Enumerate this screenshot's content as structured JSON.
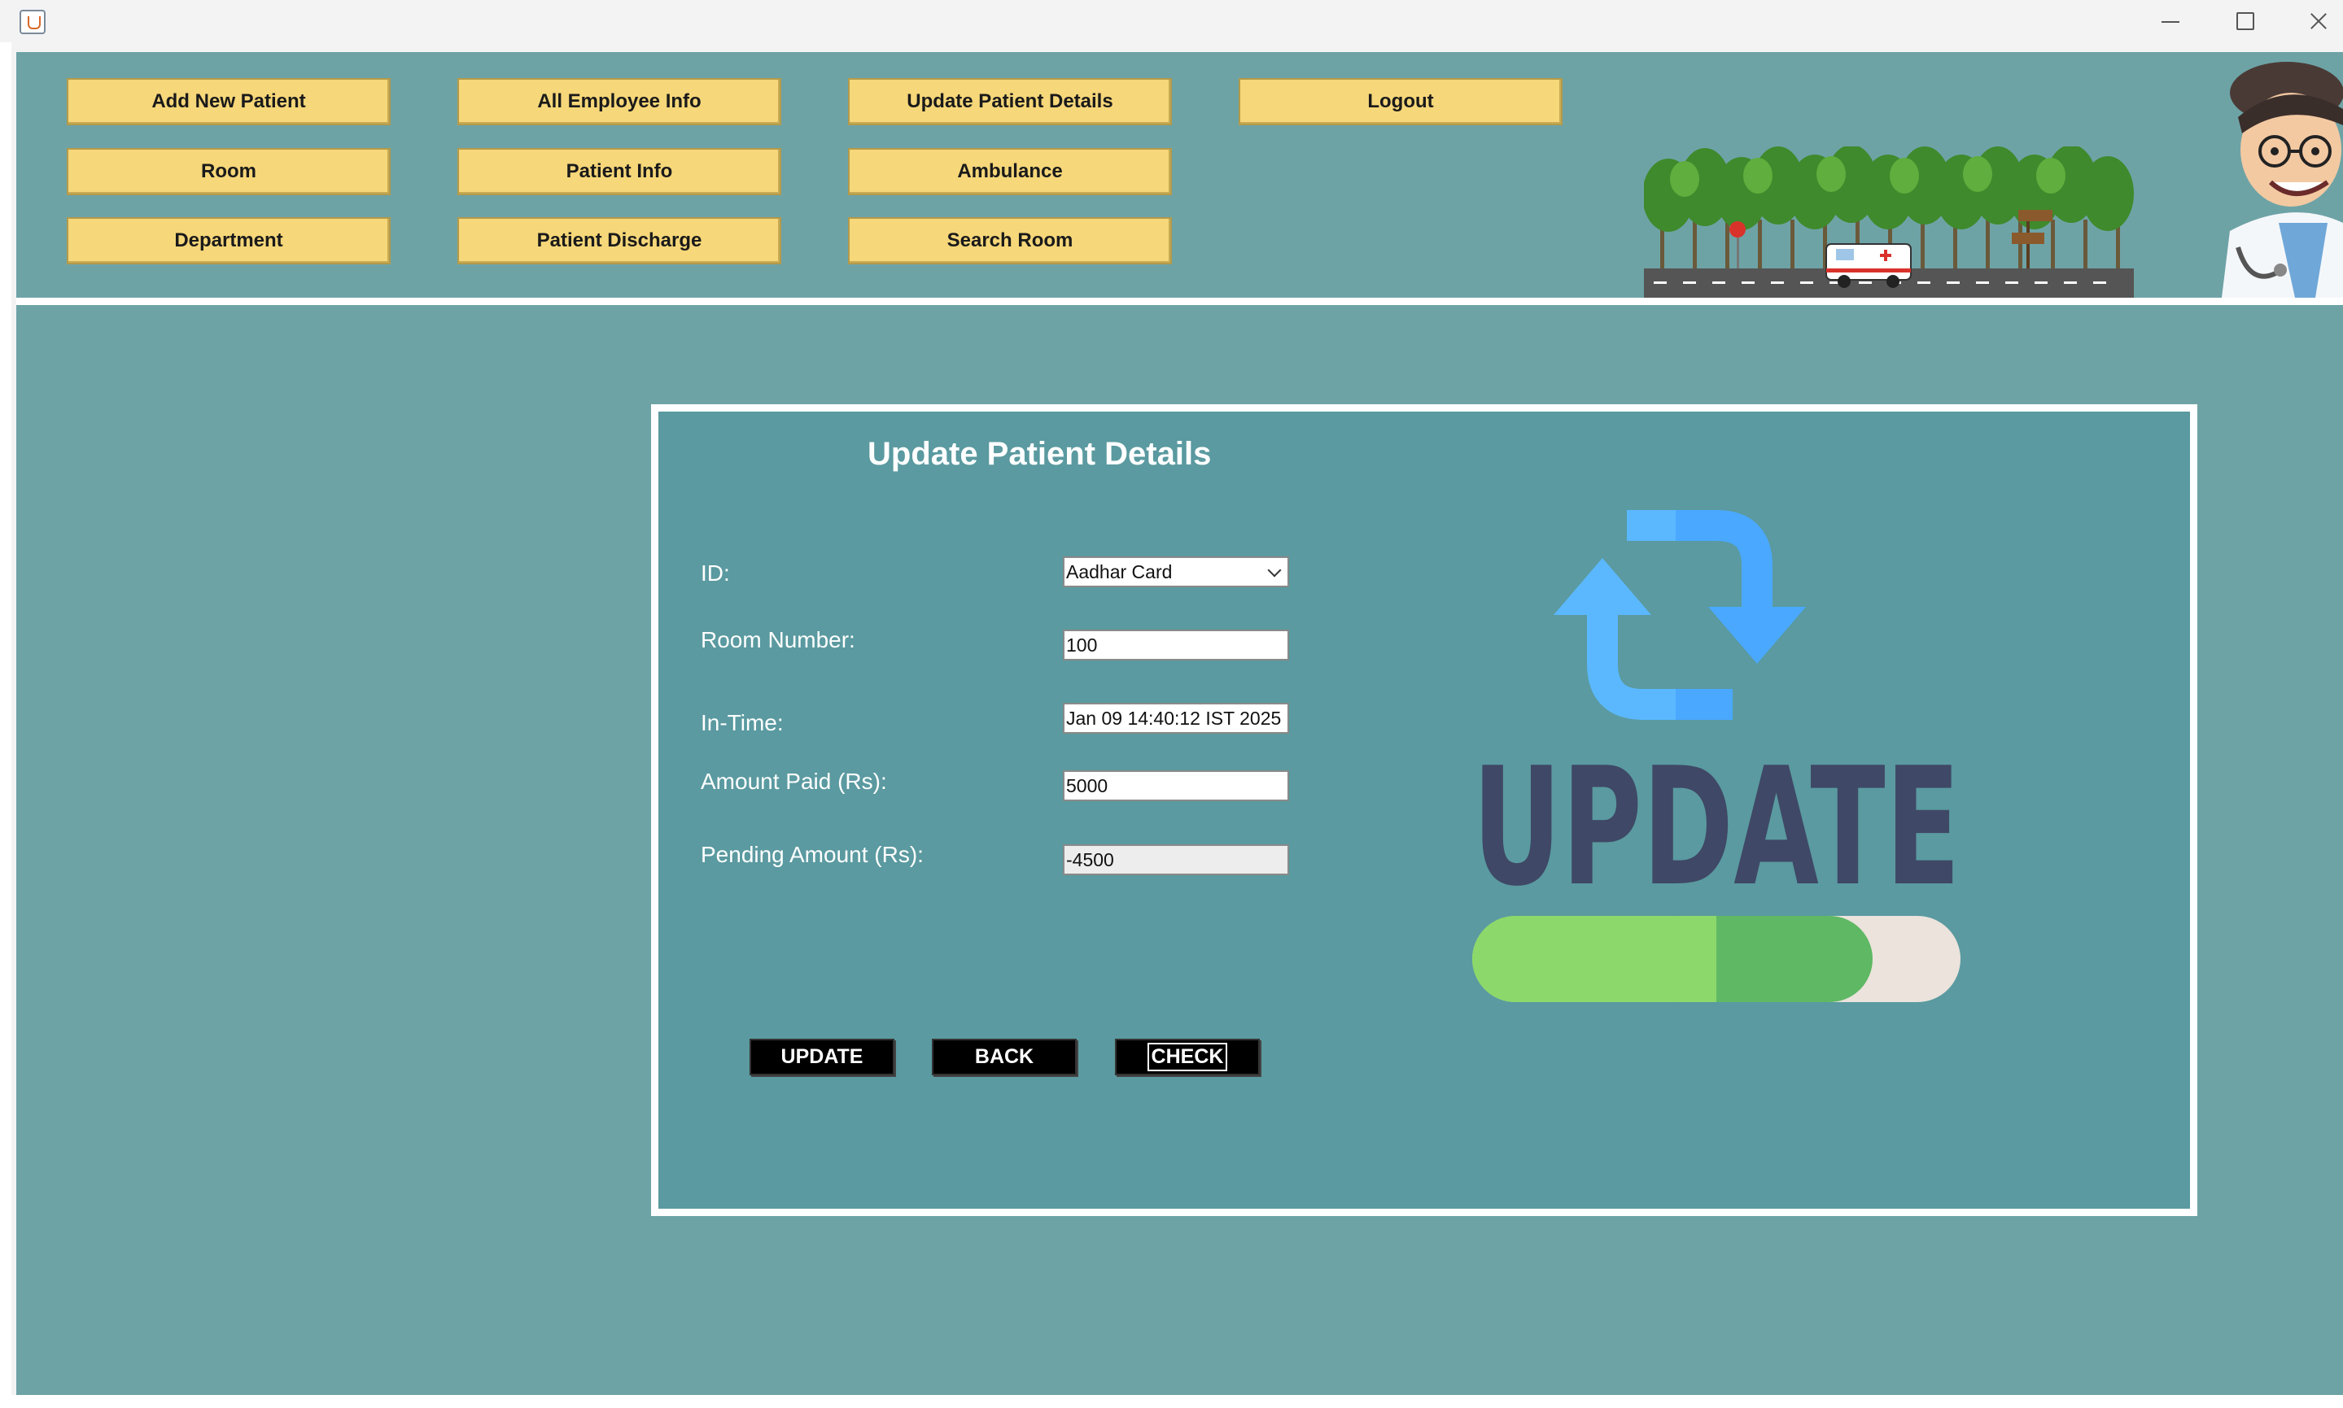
{
  "window": {
    "app_icon": "java-cup-icon"
  },
  "nav": {
    "add_new_patient": "Add New Patient",
    "all_employee_info": "All Employee Info",
    "update_patient_details": "Update Patient Details",
    "logout": "Logout",
    "room": "Room",
    "patient_info": "Patient Info",
    "ambulance": "Ambulance",
    "department": "Department",
    "patient_discharge": "Patient Discharge",
    "search_room": "Search Room"
  },
  "form": {
    "title": "Update Patient Details",
    "id_label": "ID:",
    "id_value": "Aadhar Card",
    "room_label": "Room Number:",
    "room_value": "100",
    "intime_label": "In-Time:",
    "intime_value": "Jan 09 14:40:12 IST 2025",
    "amount_label": "Amount Paid (Rs):",
    "amount_value": "5000",
    "pending_label": "Pending Amount (Rs):",
    "pending_value": "-4500"
  },
  "actions": {
    "update": "UPDATE",
    "back": "BACK",
    "check": "CHECK"
  },
  "graphic": {
    "word": "UPDATE",
    "progress": 0.82
  },
  "colors": {
    "panel_bg": "#6ea3a6",
    "card_bg": "#5a9aa0",
    "nav_button": "#f6d779",
    "action_button": "#000000",
    "arrow_blue": "#4aa8ff",
    "update_text": "#3f4866",
    "progress_green": "#8cd86a"
  }
}
